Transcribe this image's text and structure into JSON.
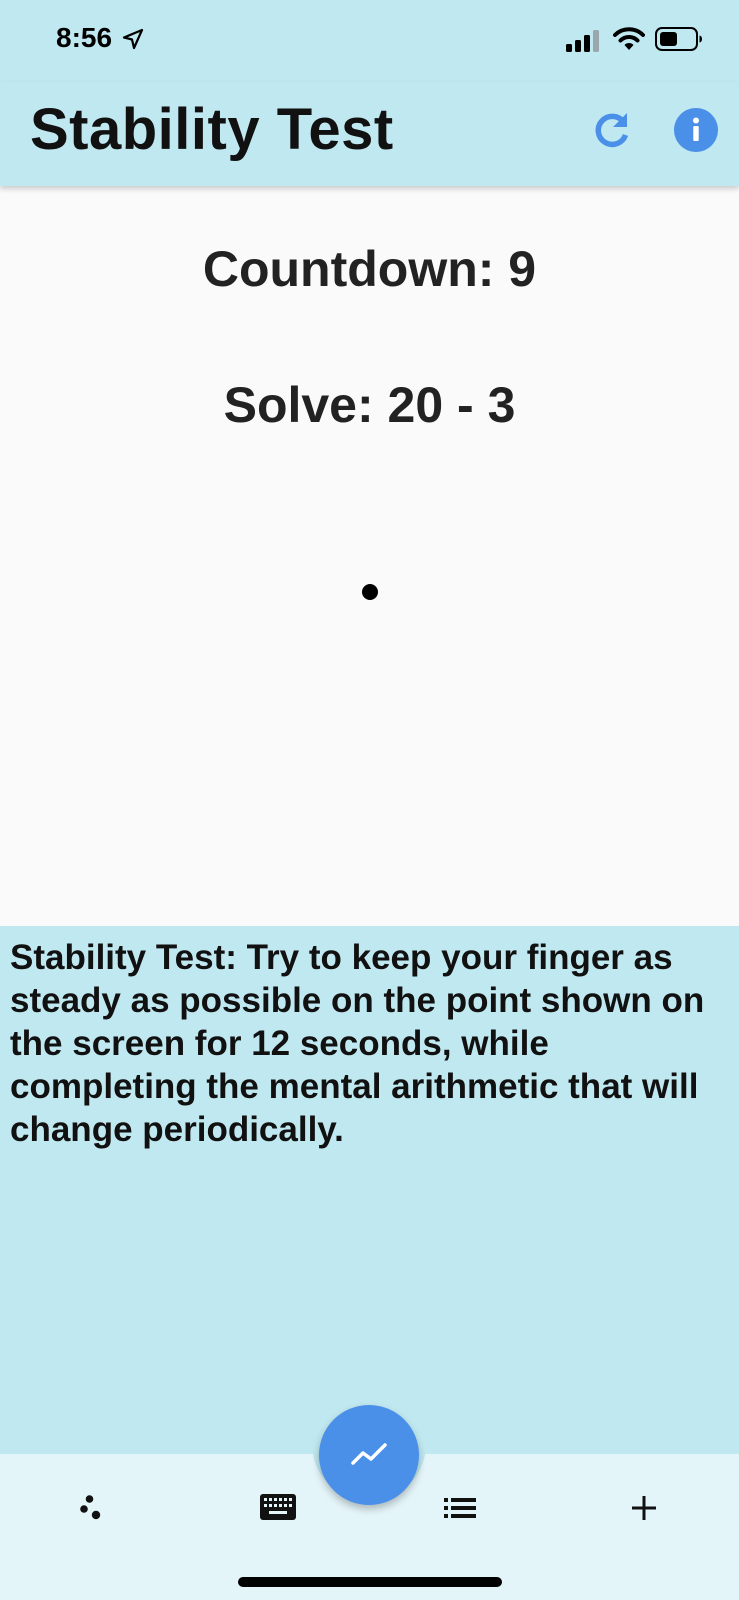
{
  "status_bar": {
    "time": "8:56"
  },
  "app_bar": {
    "title": "Stability Test",
    "actions": [
      {
        "icon": "refresh-icon"
      },
      {
        "icon": "info-icon"
      }
    ]
  },
  "test": {
    "countdown_text": "Countdown: 9",
    "solve_text": "Solve: 20 - 3"
  },
  "instructions": {
    "text": "Stability Test: Try to keep your finger as steady as possible on the point shown on the screen for 12 seconds, while completing the mental arithmetic that will change periodically."
  },
  "bottom_nav": {
    "items": [
      {
        "icon": "dots-icon"
      },
      {
        "icon": "keyboard-icon"
      },
      {
        "icon": "list-icon"
      },
      {
        "icon": "add-icon"
      }
    ],
    "fab_icon": "trending-icon"
  },
  "colors": {
    "bar_background": "#c0e8f0",
    "accent": "#4a8fe8",
    "bottom_bar": "#e4f5fa"
  }
}
